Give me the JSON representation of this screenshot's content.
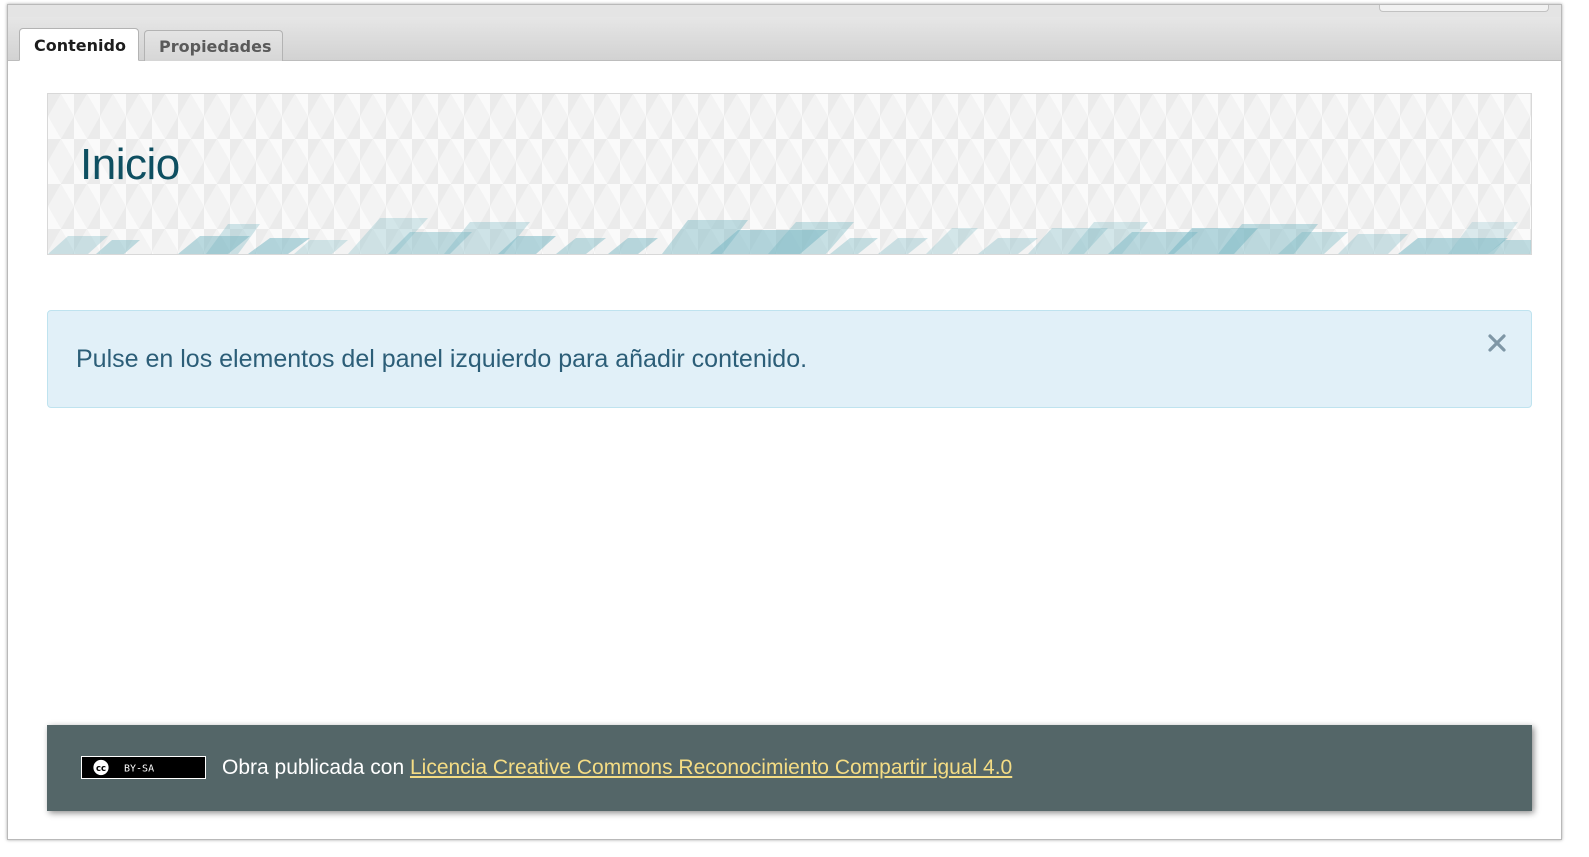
{
  "tabs": [
    {
      "label": "Contenido",
      "active": true
    },
    {
      "label": "Propiedades",
      "active": false
    }
  ],
  "header": {
    "title": "Inicio"
  },
  "alert": {
    "message": "Pulse en los elementos del panel izquierdo para añadir contenido.",
    "close_icon": "close-icon"
  },
  "footer": {
    "badge_icon": "cc-by-sa-badge-icon",
    "badge_text": "BY-SA",
    "text": "Obra publicada con",
    "link_label": "Licencia Creative Commons Reconocimiento Compartir igual 4.0"
  },
  "colors": {
    "title": "#0e4f61",
    "alert_background": "#e1f0f8",
    "alert_text": "#2c5e78",
    "footer_background": "#546668",
    "footer_link": "#f4dc84"
  }
}
